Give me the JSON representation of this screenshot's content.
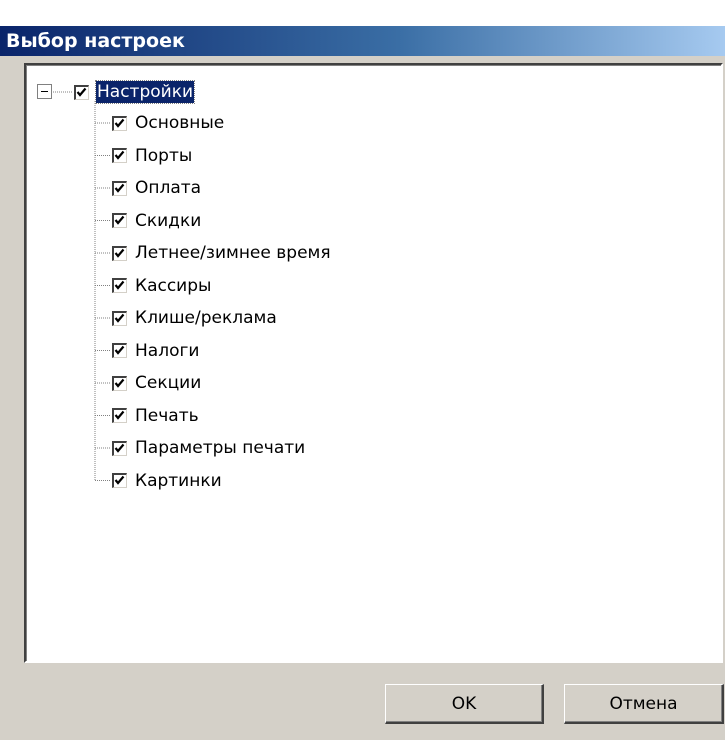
{
  "window": {
    "title": "Выбор настроек"
  },
  "tree": {
    "root": {
      "label": "Настройки",
      "checked": true,
      "expanded": true,
      "selected": true
    },
    "items": [
      {
        "label": "Основные",
        "checked": true
      },
      {
        "label": "Порты",
        "checked": true
      },
      {
        "label": "Оплата",
        "checked": true
      },
      {
        "label": "Скидки",
        "checked": true
      },
      {
        "label": "Летнее/зимнее время",
        "checked": true
      },
      {
        "label": "Кассиры",
        "checked": true
      },
      {
        "label": "Клише/реклама",
        "checked": true
      },
      {
        "label": "Налоги",
        "checked": true
      },
      {
        "label": "Секции",
        "checked": true
      },
      {
        "label": "Печать",
        "checked": true
      },
      {
        "label": "Параметры печати",
        "checked": true
      },
      {
        "label": "Картинки",
        "checked": true
      }
    ]
  },
  "buttons": {
    "ok_label": "OK",
    "cancel_label": "Отмена"
  },
  "icons": {
    "expander": "collapse-minus-icon",
    "checkbox": "checkmark-icon"
  },
  "colors": {
    "title_bar_start": "#0a246a",
    "title_bar_end": "#a6caf0",
    "selection": "#0a246a",
    "face": "#d4d0c8"
  }
}
